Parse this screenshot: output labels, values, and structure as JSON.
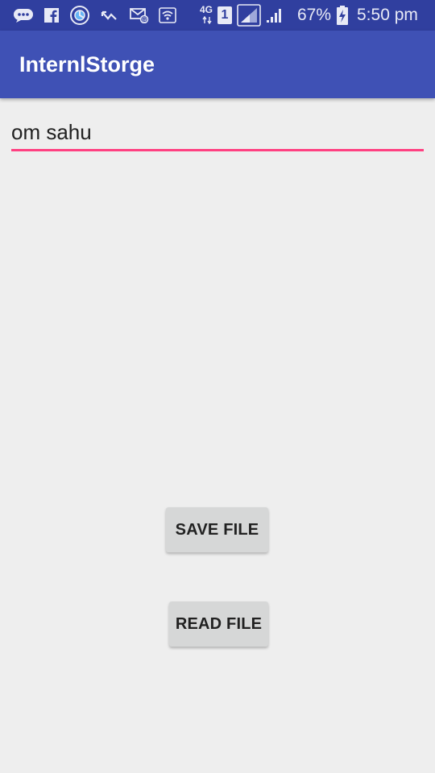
{
  "status_bar": {
    "network_type": "4G",
    "sim_slot": "1",
    "battery_percent": "67%",
    "time": "5:50 pm",
    "icons": [
      "messenger-icon",
      "facebook-icon",
      "sync-icon",
      "missed-call-icon",
      "email-icon",
      "wifi-icon",
      "network-type-icon",
      "sim-1-icon",
      "signal-icon",
      "signal-weak-icon",
      "battery-charging-icon"
    ]
  },
  "app_bar": {
    "title": "InternlStorge",
    "color": "#3f51b5"
  },
  "text_field": {
    "value": "om sahu",
    "underline_color": "#ff4081"
  },
  "buttons": {
    "save_label": "SAVE FILE",
    "read_label": "READ FILE"
  }
}
